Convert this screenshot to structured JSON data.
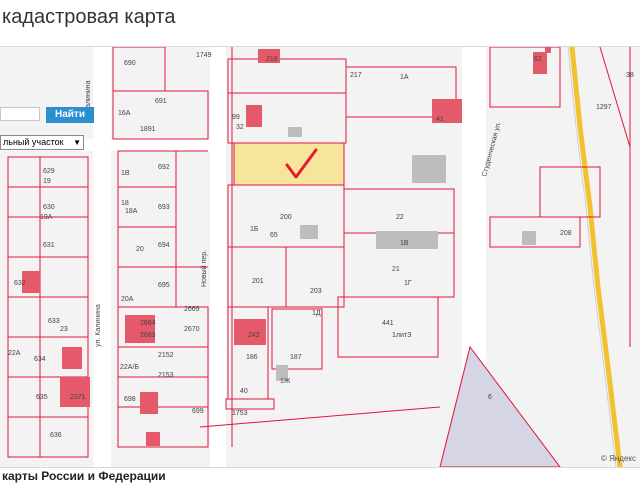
{
  "header": {
    "title": "кадастровая карта"
  },
  "search": {
    "input_value": "",
    "button_label": "Найти"
  },
  "filter": {
    "selected": "льный участок"
  },
  "colors": {
    "parcel_border": "#e0153b",
    "building_fill": "#e45a6a",
    "selection_fill": "#f6e59a",
    "checkmark": "#e11d2e",
    "road": "#ffffff",
    "highway": "#f2c12e"
  },
  "streets": [
    "ул. Калинина",
    "Новый пер.",
    "Студенческая ул.",
    "Калинина"
  ],
  "parcels": [
    "690",
    "691",
    "1891",
    "16А",
    "217",
    "1А",
    "99",
    "32",
    "41",
    "218",
    "1297",
    "62",
    "38",
    "692",
    "1В",
    "629",
    "19",
    "630",
    "19А",
    "631",
    "632",
    "20",
    "693",
    "18А",
    "18",
    "694",
    "200",
    "1Б",
    "22",
    "65",
    "1В",
    "208",
    "695",
    "20А",
    "201",
    "203",
    "21",
    "1Г",
    "2669",
    "2684",
    "2683",
    "2670",
    "633",
    "23",
    "634",
    "22А",
    "2152",
    "2153",
    "22А/Б",
    "441",
    "1литЗ",
    "1Д",
    "242",
    "186",
    "187",
    "1Ж",
    "635",
    "2371",
    "698",
    "699",
    "1753",
    "40",
    "636",
    "6",
    "1749"
  ],
  "attribution": "© Яндекс",
  "footer": "карты России и Федерации"
}
